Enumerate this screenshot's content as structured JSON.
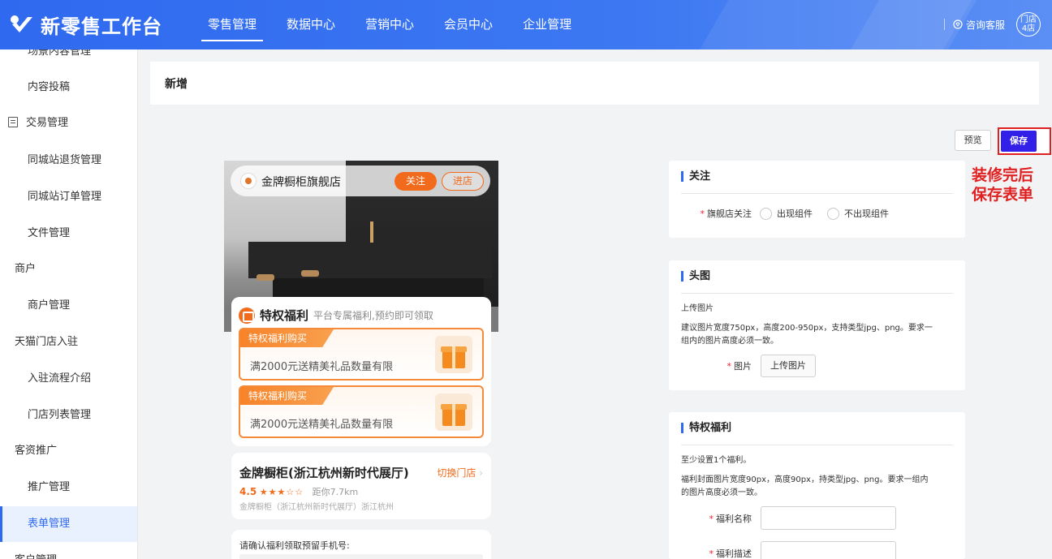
{
  "app": {
    "title": "新零售工作台"
  },
  "nav": {
    "items": [
      "零售管理",
      "数据中心",
      "营销中心",
      "会员中心",
      "企业管理"
    ],
    "active": 0
  },
  "header": {
    "help_label": "咨询客服",
    "avatar_line1": "门店",
    "avatar_line2": "4店"
  },
  "sidebar": {
    "items": [
      {
        "label": "场景内容管理"
      },
      {
        "label": "内容投稿"
      },
      {
        "label": "交易管理"
      },
      {
        "label": "同城站退货管理"
      },
      {
        "label": "同城站订单管理"
      },
      {
        "label": "文件管理"
      },
      {
        "label": "商户"
      },
      {
        "label": "商户管理"
      },
      {
        "label": "天猫门店入驻"
      },
      {
        "label": "入驻流程介绍"
      },
      {
        "label": "门店列表管理"
      },
      {
        "label": "客资推广"
      },
      {
        "label": "推广管理"
      },
      {
        "label": "表单管理"
      },
      {
        "label": "客户管理"
      }
    ],
    "active_label": "表单管理"
  },
  "page": {
    "title": "新增",
    "preview_label": "预览",
    "save_label": "保存",
    "annotation_line1": "装修完后",
    "annotation_line2": "保存表单"
  },
  "preview": {
    "store_name": "金牌橱柜旗舰店",
    "follow_label": "关注",
    "enter_label": "进店",
    "perk_title": "特权福利",
    "perk_sub": "平台专属福利,预约即可领取",
    "coupons": [
      {
        "tag": "特权福利购买",
        "text": "满2000元送精美礼品数量有限"
      },
      {
        "tag": "特权福利购买",
        "text": "满2000元送精美礼品数量有限"
      }
    ],
    "shop_name": "金牌橱柜(浙江杭州新时代展厅)",
    "switch_store": "切换门店",
    "score": "4.5",
    "stars": "★★★☆☆",
    "distance": "距你7.7km",
    "address": "金牌橱柜（浙江杭州新时代展厅）浙江杭州",
    "phone_prompt": "请确认福利领取预留手机号:"
  },
  "form": {
    "follow": {
      "section": "关注",
      "label": "旗舰店关注",
      "options": [
        "出现组件",
        "不出现组件"
      ]
    },
    "head_image": {
      "section": "头图",
      "upload_title": "上传图片",
      "hint_line1": "建议图片宽度750px，高度200-950px，支持类型jpg、png。要求一",
      "hint_line2": "组内的图片高度必须一致。",
      "field_label": "图片",
      "button": "上传图片"
    },
    "perks": {
      "section": "特权福利",
      "hint1": "至少设置1个福利。",
      "hint2_line1": "福利封面图片宽度90px，高度90px，持类型jpg、png。要求一组内",
      "hint2_line2": "的图片高度必须一致。",
      "name_label": "福利名称",
      "desc_label": "福利描述",
      "name_value": "",
      "desc_value": ""
    }
  },
  "colors": {
    "primary": "#2f69ef",
    "save": "#3320e8",
    "annotation": "#e02020",
    "accent": "#f26a1b"
  }
}
